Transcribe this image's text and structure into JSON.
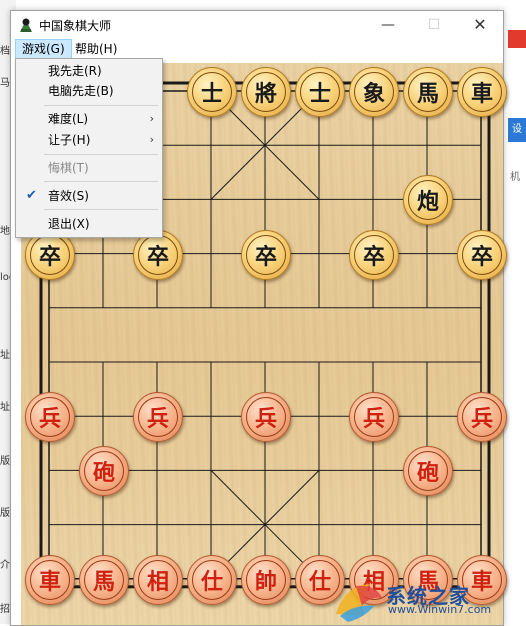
{
  "background": {
    "left_fragments": [
      "档",
      "马",
      "地",
      "log",
      "址",
      "址",
      "版本",
      "版本",
      "介绍",
      "招"
    ],
    "right_fragment_blue": "设",
    "right_fragment": "机"
  },
  "window": {
    "title": "中国象棋大师",
    "minimize_icon": "minimize-icon",
    "maximize_icon": "maximize-icon",
    "close_icon": "close-icon",
    "minimize_glyph": "—",
    "maximize_glyph": "☐",
    "close_glyph": "✕"
  },
  "menubar": {
    "game": "游戏(G)",
    "help": "帮助(H)"
  },
  "game_menu": {
    "items": [
      {
        "label": "我先走(R)",
        "enabled": true
      },
      {
        "label": "电脑先走(B)",
        "enabled": true
      },
      {
        "label": "难度(L)",
        "enabled": true,
        "submenu": true
      },
      {
        "label": "让子(H)",
        "enabled": true,
        "submenu": true
      },
      {
        "label": "悔棋(T)",
        "enabled": false
      },
      {
        "label": "音效(S)",
        "enabled": true,
        "checked": true
      },
      {
        "label": "退出(X)",
        "enabled": true
      }
    ],
    "submenu_glyph": "›",
    "check_glyph": "✔"
  },
  "pieces": [
    {
      "id": "b-shi-1",
      "char": "士",
      "side": "black",
      "col": 3,
      "row": 0
    },
    {
      "id": "b-jiang",
      "char": "將",
      "side": "black",
      "col": 4,
      "row": 0
    },
    {
      "id": "b-shi-2",
      "char": "士",
      "side": "black",
      "col": 5,
      "row": 0
    },
    {
      "id": "b-xiang-2",
      "char": "象",
      "side": "black",
      "col": 6,
      "row": 0
    },
    {
      "id": "b-ma-2",
      "char": "馬",
      "side": "black",
      "col": 7,
      "row": 0
    },
    {
      "id": "b-ju-2",
      "char": "車",
      "side": "black",
      "col": 8,
      "row": 0
    },
    {
      "id": "b-pao-2",
      "char": "炮",
      "side": "black",
      "col": 7,
      "row": 2
    },
    {
      "id": "b-zu-1",
      "char": "卒",
      "side": "black",
      "col": 0,
      "row": 3
    },
    {
      "id": "b-zu-2",
      "char": "卒",
      "side": "black",
      "col": 2,
      "row": 3
    },
    {
      "id": "b-zu-3",
      "char": "卒",
      "side": "black",
      "col": 4,
      "row": 3
    },
    {
      "id": "b-zu-4",
      "char": "卒",
      "side": "black",
      "col": 6,
      "row": 3
    },
    {
      "id": "b-zu-5",
      "char": "卒",
      "side": "black",
      "col": 8,
      "row": 3
    },
    {
      "id": "r-bing-1",
      "char": "兵",
      "side": "red",
      "col": 0,
      "row": 6
    },
    {
      "id": "r-bing-2",
      "char": "兵",
      "side": "red",
      "col": 2,
      "row": 6
    },
    {
      "id": "r-bing-3",
      "char": "兵",
      "side": "red",
      "col": 4,
      "row": 6
    },
    {
      "id": "r-bing-4",
      "char": "兵",
      "side": "red",
      "col": 6,
      "row": 6
    },
    {
      "id": "r-bing-5",
      "char": "兵",
      "side": "red",
      "col": 8,
      "row": 6
    },
    {
      "id": "r-pao-1",
      "char": "砲",
      "side": "red",
      "col": 1,
      "row": 7
    },
    {
      "id": "r-pao-2",
      "char": "砲",
      "side": "red",
      "col": 7,
      "row": 7
    },
    {
      "id": "r-ju-1",
      "char": "車",
      "side": "red",
      "col": 0,
      "row": 9
    },
    {
      "id": "r-ma-1",
      "char": "馬",
      "side": "red",
      "col": 1,
      "row": 9
    },
    {
      "id": "r-xiang-1",
      "char": "相",
      "side": "red",
      "col": 2,
      "row": 9
    },
    {
      "id": "r-shi-1",
      "char": "仕",
      "side": "red",
      "col": 3,
      "row": 9
    },
    {
      "id": "r-shuai",
      "char": "帥",
      "side": "red",
      "col": 4,
      "row": 9
    },
    {
      "id": "r-shi-2",
      "char": "仕",
      "side": "red",
      "col": 5,
      "row": 9
    },
    {
      "id": "r-xiang-2",
      "char": "相",
      "side": "red",
      "col": 6,
      "row": 9
    },
    {
      "id": "r-ma-2",
      "char": "馬",
      "side": "red",
      "col": 7,
      "row": 9
    },
    {
      "id": "r-ju-2",
      "char": "車",
      "side": "red",
      "col": 8,
      "row": 9
    }
  ],
  "watermark": {
    "text": "系统之家",
    "url": "www.Winwin7.com"
  },
  "colors": {
    "board_line": "#1a1a1a",
    "red_text": "#d02010",
    "menu_highlight": "#cce8ff"
  }
}
